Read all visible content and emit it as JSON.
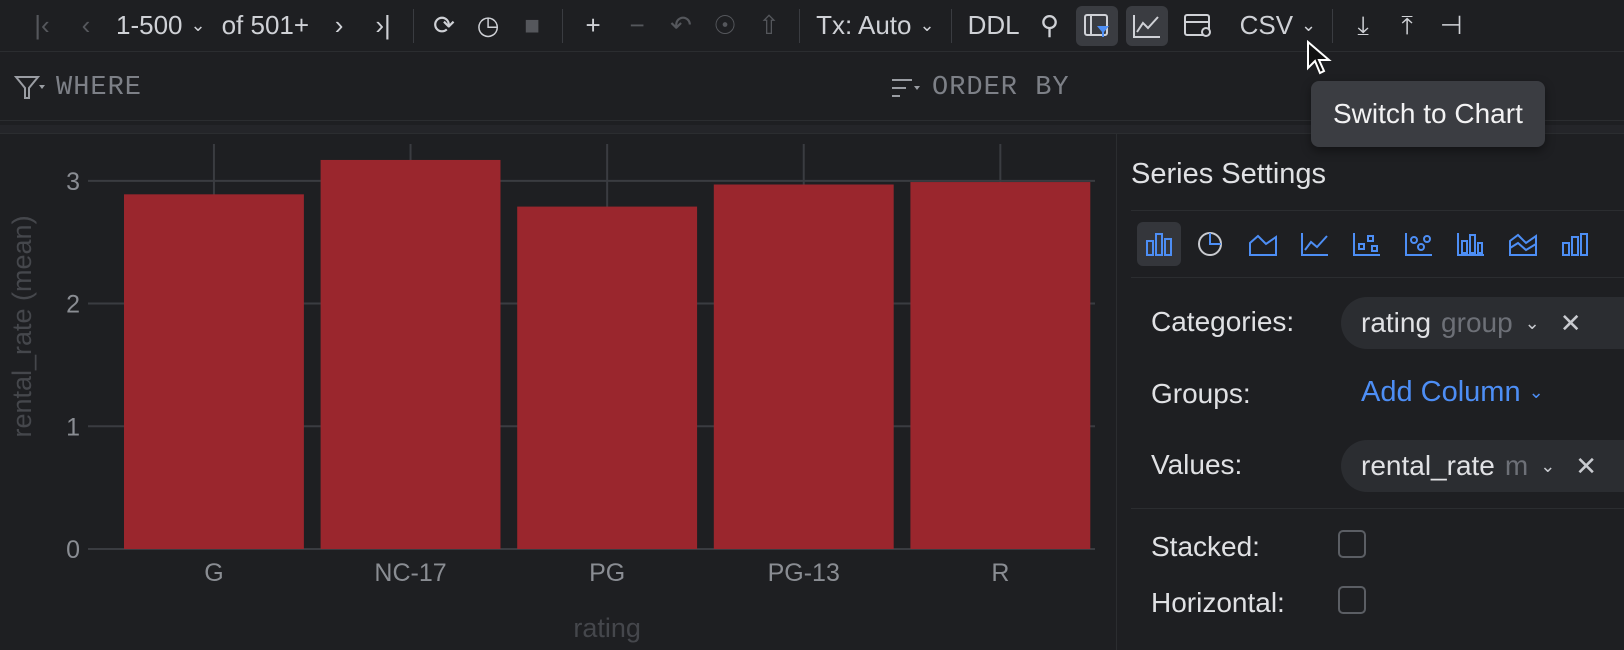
{
  "toolbar": {
    "range": "1-500",
    "of_total": "of 501+",
    "tx_mode": "Tx: Auto",
    "ddl": "DDL",
    "export_format": "CSV"
  },
  "filter_bar": {
    "where": "WHERE",
    "order_by": "ORDER BY"
  },
  "tooltip": "Switch to Chart",
  "panel": {
    "title": "Series Settings",
    "categories_label": "Categories:",
    "categories_value": "rating",
    "categories_agg": "group",
    "groups_label": "Groups:",
    "groups_action": "Add Column",
    "values_label": "Values:",
    "values_value": "rental_rate",
    "values_agg": "m",
    "stacked_label": "Stacked:",
    "horizontal_label": "Horizontal:"
  },
  "chart_data": {
    "type": "bar",
    "categories": [
      "G",
      "NC-17",
      "PG",
      "PG-13",
      "R"
    ],
    "values": [
      2.89,
      3.17,
      2.79,
      2.97,
      2.99
    ],
    "xlabel": "rating",
    "ylabel": "rental_rate (mean)",
    "ylim": [
      0,
      3.3
    ],
    "yticks": [
      0,
      1,
      2,
      3
    ],
    "bar_color": "#9a262d",
    "grid": true
  },
  "colors": {
    "accent": "#4d8ef5",
    "background": "#1e1f22",
    "bar": "#9a262d"
  }
}
